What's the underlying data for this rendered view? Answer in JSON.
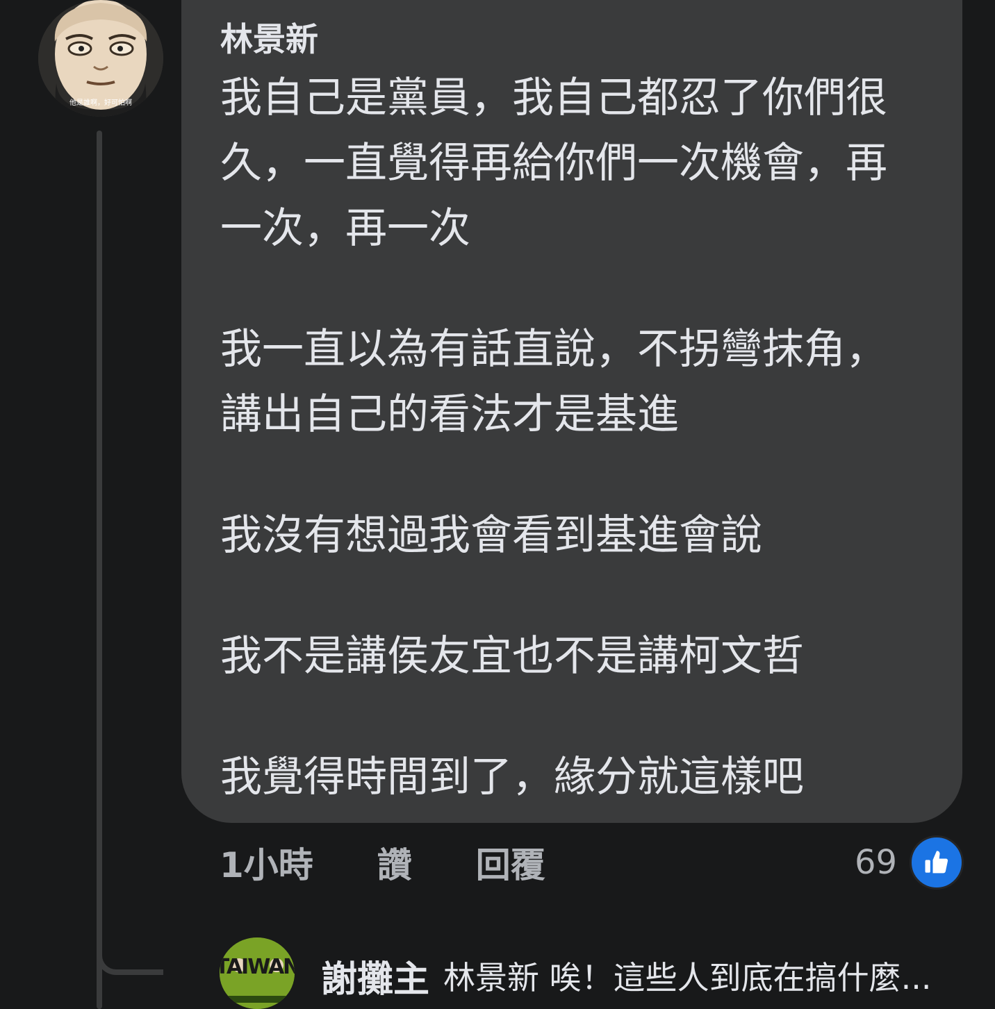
{
  "comment": {
    "author": "林景新",
    "avatar_caption": "他是誰啊，好可怕啊",
    "paragraphs": [
      "我自己是黨員，我自己都忍了你們很久，一直覺得再給你們一次機會，再一次，再一次",
      "我一直以為有話直說，不拐彎抹角，講出自己的看法才是基進",
      "我沒有想過我會看到基進會說",
      "我不是講侯友宜也不是講柯文哲",
      "我覺得時間到了，緣分就這樣吧"
    ],
    "timestamp": "1小時",
    "like_label": "讚",
    "reply_label": "回覆",
    "reaction_count": "69",
    "reaction_icon": "thumbs-up-icon"
  },
  "reply": {
    "author": "謝攤主",
    "snippet": "林景新 唉！這些人到底在搞什麼...",
    "avatar_text": "TAIWAN"
  },
  "colors": {
    "background": "#18191a",
    "bubble": "#3a3b3c",
    "text": "#e4e6eb",
    "muted": "#b0b3b8",
    "like_blue": "#1b74e4"
  }
}
